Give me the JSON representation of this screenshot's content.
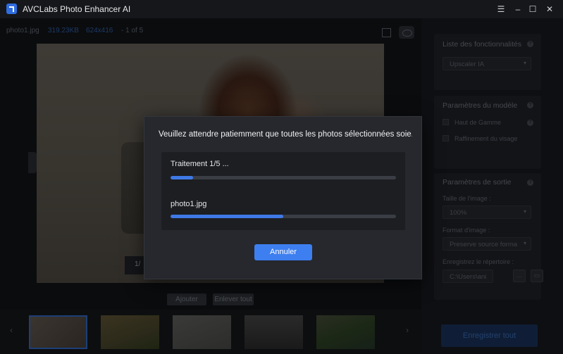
{
  "app": {
    "title": "AVCLabs Photo Enhancer AI"
  },
  "window_controls": {
    "menu": "☰",
    "minimize": "–",
    "maximize": "☐",
    "close": "✕"
  },
  "file_info": {
    "name": "photo1.jpg",
    "size": "319.23KB",
    "dimensions": "624x416",
    "index": "- 1 of 5"
  },
  "preview": {
    "compare_tag": "1/"
  },
  "workarea_buttons": {
    "add": "Ajouter",
    "remove_all": "Enlever tout"
  },
  "filmstrip": {
    "prev": "‹",
    "next": "›"
  },
  "right_panel": {
    "features": {
      "title": "Liste des fonctionnalités",
      "selected": "Upscaler IA"
    },
    "model": {
      "title": "Paramètres du modèle",
      "options": [
        "Haut de Gamme",
        "Raffinement du visage"
      ]
    },
    "output": {
      "title": "Paramètres de sortie",
      "size_label": "Taille de l'image :",
      "size_value": "100%",
      "format_label": "Format d'image :",
      "format_value": "Preserve source forma",
      "dir_label": "Enregistrez le répertoire :",
      "dir_value": "C:\\Users\\ani",
      "dots": "..."
    },
    "export_label": "Enregistrer tout"
  },
  "modal": {
    "message": "Veuillez attendre patiemment que toutes les photos sélectionnées soie...",
    "overall_label": "Traitement 1/5 ...",
    "overall_progress": 0.1,
    "file_label": "photo1.jpg",
    "file_progress": 0.5,
    "cancel_label": "Annuler"
  },
  "colors": {
    "accent": "#3d7ff0",
    "progress": "#3f79e6",
    "modal_bg": "#26282d"
  }
}
